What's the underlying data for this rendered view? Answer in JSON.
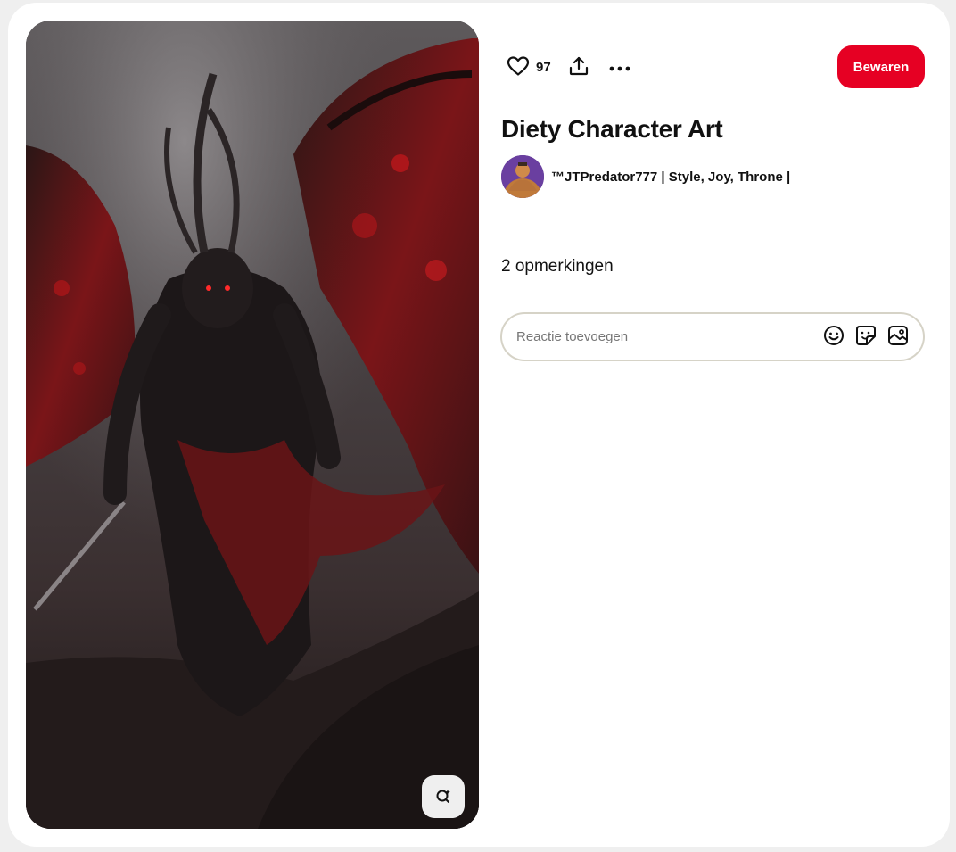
{
  "pin": {
    "title": "Diety Character Art",
    "like_count": "97"
  },
  "creator": {
    "name": "™JTPredator777 | Style, Joy, Throne |"
  },
  "actions": {
    "save_label": "Bewaren"
  },
  "comments": {
    "count_label": "2 opmerkingen",
    "input_placeholder": "Reactie toevoegen"
  },
  "icons": {
    "like": "heart-icon",
    "share": "share-icon",
    "more": "more-dots-icon",
    "visual_search": "visual-search-icon",
    "emoji": "emoji-icon",
    "sticker": "sticker-icon",
    "image": "image-upload-icon"
  },
  "colors": {
    "accent": "#e60023",
    "background": "#efefef",
    "card": "#ffffff",
    "input_border": "#d6d3c7"
  }
}
